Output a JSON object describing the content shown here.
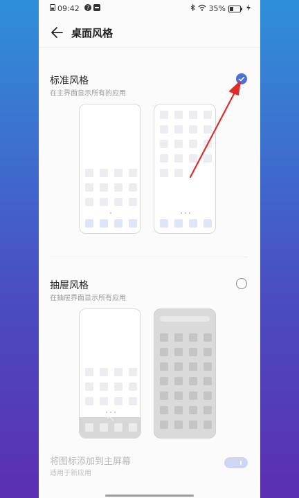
{
  "status_bar": {
    "time": "09:42",
    "battery": "35%",
    "battery_level": 0.35
  },
  "header": {
    "title": "桌面风格"
  },
  "options": [
    {
      "title": "标准风格",
      "subtitle": "在主界面显示所有的应用",
      "selected": true
    },
    {
      "title": "抽屉风格",
      "subtitle": "在抽屉界面显示所有应用",
      "selected": false
    }
  ],
  "footer": {
    "title": "将图标添加到主屏幕",
    "subtitle": "适用于新应用",
    "toggle_on": true
  },
  "colors": {
    "accent": "#4a6fdc",
    "annotation_arrow": "#e02b2b"
  }
}
